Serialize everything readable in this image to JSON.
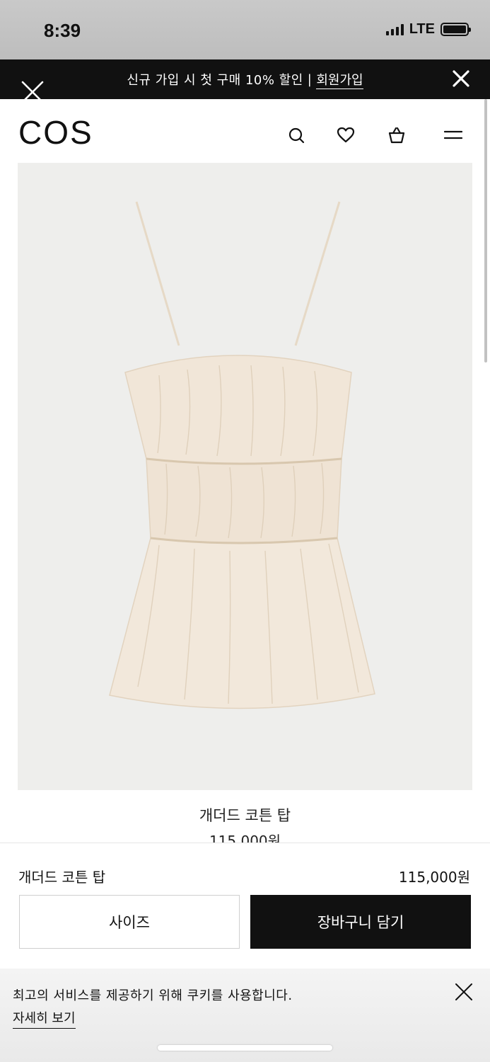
{
  "status_bar": {
    "time": "8:39",
    "network": "LTE"
  },
  "promo": {
    "text": "신규 가입 시 첫 구매 10% 할인",
    "separator": "|",
    "link_label": "회원가입"
  },
  "header": {
    "logo": "COS",
    "icons": [
      "search-icon",
      "heart-icon",
      "bag-icon",
      "menu-icon"
    ]
  },
  "product": {
    "title": "개더드 코튼 탑",
    "price": "115,000원",
    "image_background": "#eeeeec",
    "garment_color": "#f1e6d8"
  },
  "purchase_bar": {
    "name": "개더드 코튼 탑",
    "price": "115,000원",
    "size_button_label": "사이즈",
    "add_to_cart_label": "장바구니 담기"
  },
  "cookie_banner": {
    "message": "최고의 서비스를 제공하기 위해 쿠키를 사용합니다.",
    "details_link": "자세히 보기"
  },
  "colors": {
    "accent": "#111111",
    "background": "#ffffff"
  }
}
